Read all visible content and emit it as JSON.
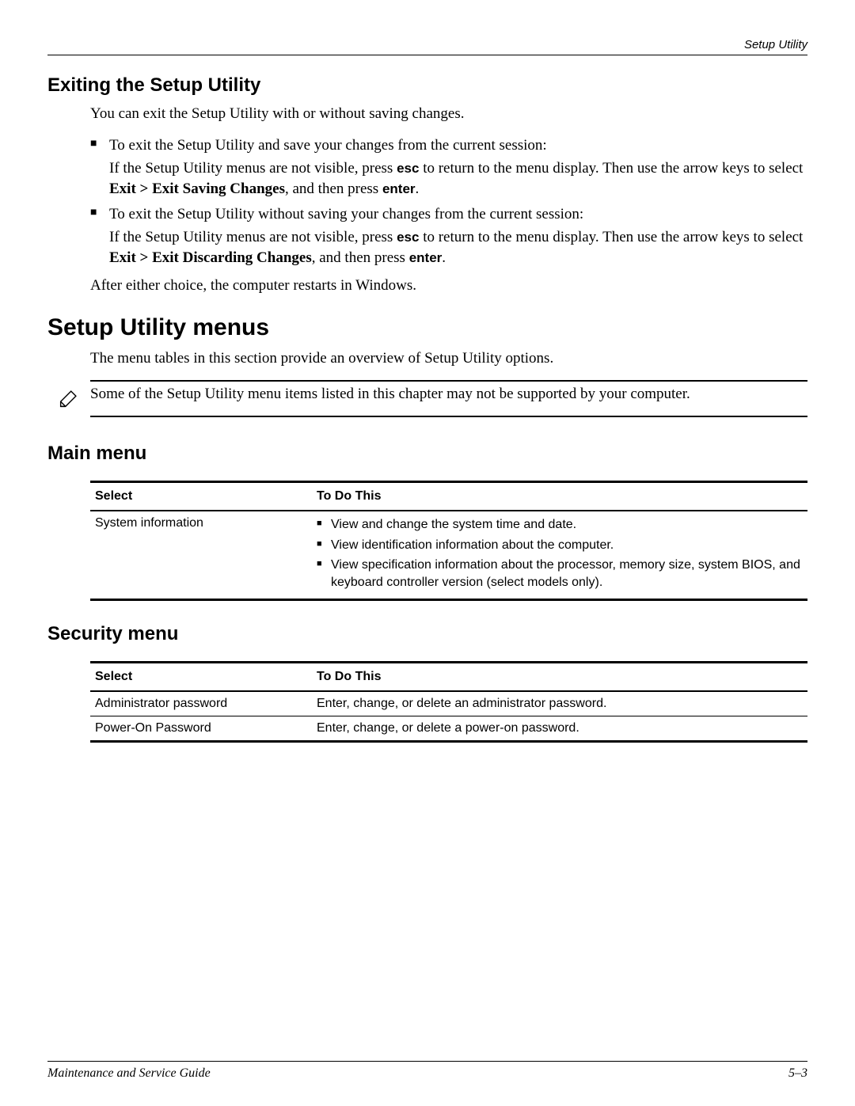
{
  "header": {
    "running_head": "Setup Utility"
  },
  "s1": {
    "heading": "Exiting the Setup Utility",
    "intro": "You can exit the Setup Utility with or without saving changes.",
    "b1_lead": "To exit the Setup Utility and save your changes from the current session:",
    "b1_sub_a": "If the Setup Utility menus are not visible, press ",
    "b1_sub_b": " to return to the menu display. Then use the arrow keys to select ",
    "b1_sub_bold": "Exit > Exit Saving Changes",
    "b1_sub_c": ", and then press ",
    "b2_lead": "To exit the Setup Utility without saving your changes from the current session:",
    "b2_sub_a": "If the Setup Utility menus are not visible, press ",
    "b2_sub_b": " to return to the menu display. Then use the arrow keys to select ",
    "b2_sub_bold": "Exit > Exit Discarding Changes",
    "b2_sub_c": ", and then press ",
    "esc": "esc",
    "enter": "enter",
    "dot": ".",
    "after": "After either choice, the computer restarts in Windows."
  },
  "s2": {
    "heading": "Setup Utility menus",
    "intro": "The menu tables in this section provide an overview of Setup Utility options.",
    "note": "Some of the Setup Utility menu items listed in this chapter may not be supported by your computer."
  },
  "main_menu": {
    "heading": "Main menu",
    "col_select": "Select",
    "col_todo": "To Do This",
    "row1_select": "System information",
    "row1_items": {
      "i0": "View and change the system time and date.",
      "i1": "View identification information about the computer.",
      "i2": "View specification information about the processor, memory size, system BIOS, and keyboard controller version (select models only)."
    }
  },
  "security_menu": {
    "heading": "Security menu",
    "col_select": "Select",
    "col_todo": "To Do This",
    "row1_select": "Administrator password",
    "row1_todo": "Enter, change, or delete an administrator password.",
    "row2_select": "Power-On Password",
    "row2_todo": "Enter, change, or delete a power-on password."
  },
  "footer": {
    "left": "Maintenance and Service Guide",
    "right": "5–3"
  }
}
